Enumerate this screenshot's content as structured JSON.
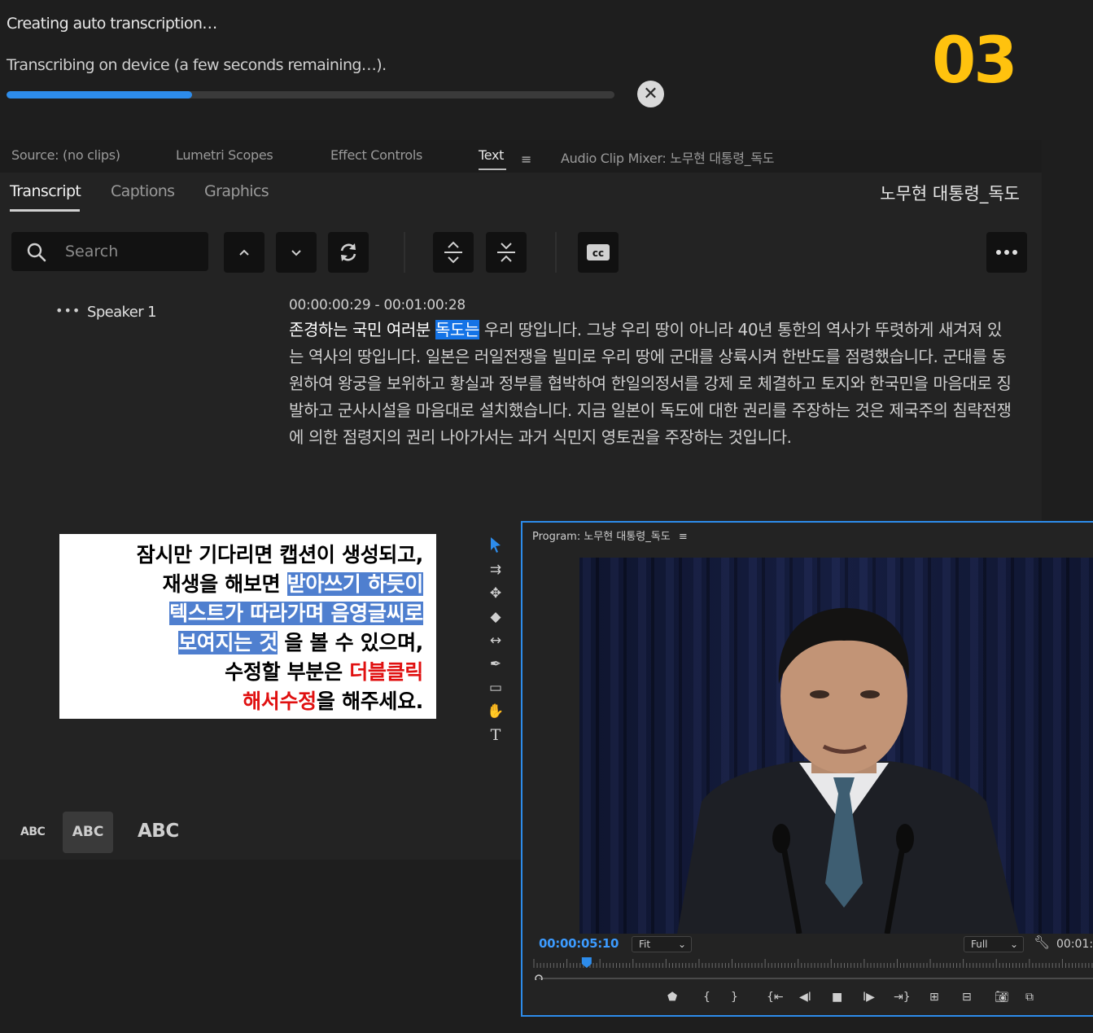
{
  "progress": {
    "title": "Creating auto transcription…",
    "subtitle": "Transcribing on device (a few seconds remaining…).",
    "fraction": 0.305,
    "cancel_icon": "close-circle-icon"
  },
  "step_number": "03",
  "panel_tabs": {
    "source": "Source: (no clips)",
    "lumetri": "Lumetri Scopes",
    "effect_controls": "Effect Controls",
    "text": "Text",
    "audio_mixer": "Audio Clip Mixer: 노무현 대통령_독도"
  },
  "subtabs": {
    "transcript": "Transcript",
    "captions": "Captions",
    "graphics": "Graphics"
  },
  "sequence_title": "노무현 대통령_독도",
  "search": {
    "placeholder": "Search"
  },
  "speaker": {
    "dots": "•••",
    "name": "Speaker 1"
  },
  "segment": {
    "timecode": "00:00:00:29 - 00:01:00:28",
    "spoken": "존경하는 국민 여러분 ",
    "highlight": "독도는",
    "rest": " 우리 땅입니다. 그냥 우리 땅이 아니라 40년 통한의 역사가 뚜렷하게 새겨져 있는 역사의 땅입니다. 일본은 러일전쟁을 빌미로 우리 땅에 군대를 상륙시켜 한반도를 점령했습니다. 군대를 동원하여 왕궁을 보위하고 황실과 정부를 협박하여 한일의정서를 강제 로 체결하고 토지와 한국민을 마음대로 징발하고 군사시설을 마음대로 설치했습니다. 지금 일본이 독도에 대한 권리를 주장하는 것은 제국주의 침략전쟁에 의한 점령지의 권리 나아가서는 과거 식민지 영토권을 주장하는 것입니다."
  },
  "text_sizes": {
    "small": "ABC",
    "medium": "ABC",
    "large": "ABC"
  },
  "callout": {
    "l1": "잠시만 기다리면 캡션이 생성되고,",
    "l2a": "재생을 해보면 ",
    "l2b": "받아쓰기 하듯이",
    "l3": "텍스트가 따라가며 음영글씨로",
    "l4a": "보여지는 것",
    "l4b": " 을 볼 수 있으며,",
    "l5a": "수정할 부분은 ",
    "l5b": "더블클릭",
    "l6a": "해서수정",
    "l6b": "을 해주세요."
  },
  "program": {
    "title": "Program: 노무현 대통령_독도",
    "menu": "≡",
    "timecode": "00:00:05:10",
    "fit": "Fit",
    "full": "Full",
    "duration": "00:01:",
    "playhead_fraction": 0.094
  },
  "colors": {
    "accent": "#2d8ceb",
    "step": "#ffc20e",
    "highlight": "#1473e6"
  }
}
